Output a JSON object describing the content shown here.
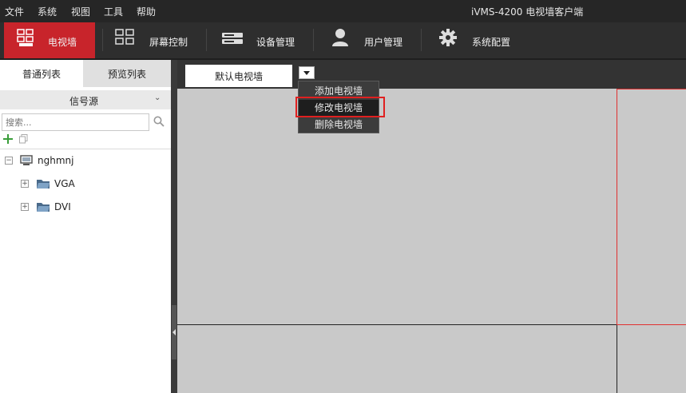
{
  "menubar": {
    "items": [
      "文件",
      "系统",
      "视图",
      "工具",
      "帮助"
    ],
    "app_title": "iVMS-4200 电视墙客户端"
  },
  "toolbar": {
    "tabs": [
      {
        "label": "电视墙",
        "icon": "tv-wall-icon",
        "active": true
      },
      {
        "label": "屏幕控制",
        "icon": "screen-grid-icon",
        "active": false
      },
      {
        "label": "设备管理",
        "icon": "device-icon",
        "active": false
      },
      {
        "label": "用户管理",
        "icon": "user-icon",
        "active": false
      },
      {
        "label": "系统配置",
        "icon": "gear-icon",
        "active": false
      }
    ],
    "active_color": "#c8242b"
  },
  "left_panel": {
    "tabs": [
      "普通列表",
      "预览列表"
    ],
    "section_title": "信号源",
    "search_placeholder": "搜索...",
    "tree": [
      {
        "label": "nghmnj",
        "level": 0,
        "icon": "monitor-icon",
        "expanded": true
      },
      {
        "label": "VGA",
        "level": 1,
        "icon": "folder-icon",
        "expanded": false
      },
      {
        "label": "DVI",
        "level": 1,
        "icon": "folder-icon",
        "expanded": false
      }
    ]
  },
  "wall": {
    "tab_label": "默认电视墙",
    "dropdown": {
      "items": [
        "添加电视墙",
        "修改电视墙",
        "删除电视墙"
      ],
      "highlighted": "修改电视墙"
    }
  }
}
